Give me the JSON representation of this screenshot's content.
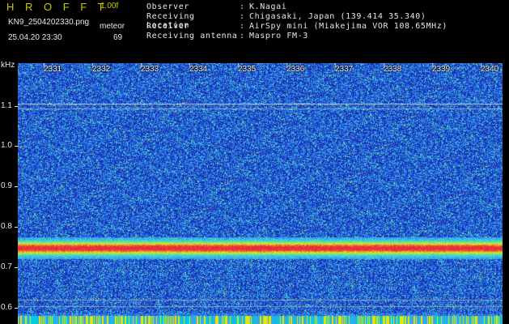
{
  "header": {
    "app_title": "H R O F F T",
    "version": "1.00f",
    "filename": "KN9_2504202330.png",
    "meteor_label": "meteor",
    "meteor_count": "69",
    "datetime": "25.04.20 23:30",
    "info": [
      {
        "key": "Observer",
        "value": "K.Nagai"
      },
      {
        "key": "Receiving Location",
        "value": "Chigasaki, Japan (139.414 35.340)"
      },
      {
        "key": "Receiver",
        "value": "AirSpy mini (Miakejima VOR 108.65MHz)"
      },
      {
        "key": "Receiving antenna",
        "value": "Maspro FM-3"
      }
    ]
  },
  "spectrogram": {
    "y_unit": "kHz",
    "y_ticks": [
      "1.1",
      "1.0",
      "0.9",
      "0.8",
      "0.7",
      "0.6"
    ],
    "x_ticks": [
      "2331",
      "2332",
      "2333",
      "2334",
      "2335",
      "2336",
      "2337",
      "2338",
      "2339",
      "2340"
    ],
    "colors": {
      "background": "#1628a0",
      "noise": "#3c6ee6",
      "meteor_line": "#e6e6e6",
      "band": "#e63c3c",
      "bottom_bar": "#e6e600"
    }
  }
}
